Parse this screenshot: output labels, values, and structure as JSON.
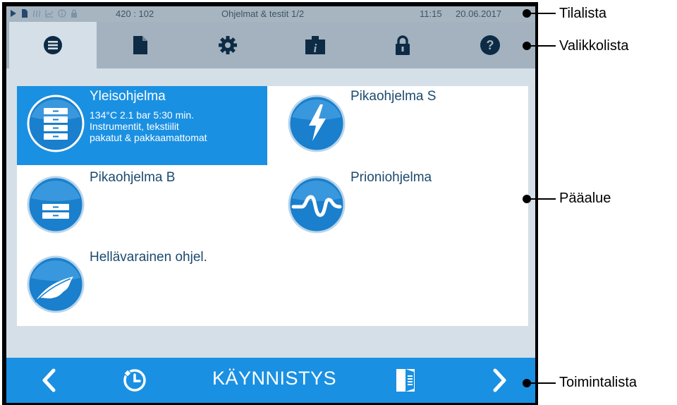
{
  "status_bar": {
    "counter": "420 : 102",
    "title": "Ohjelmat & testit 1/2",
    "time": "11:15",
    "date": "20.06.2017",
    "icons": [
      "play-icon",
      "document-icon",
      "steam-icon",
      "graph-icon",
      "info-icon",
      "lock-icon"
    ]
  },
  "menu_bar": {
    "tabs": [
      {
        "name": "programs-tab",
        "icon": "list-icon",
        "active": true
      },
      {
        "name": "documents-tab",
        "icon": "document-icon",
        "active": false
      },
      {
        "name": "settings-tab",
        "icon": "gear-icon",
        "active": false
      },
      {
        "name": "info-tab",
        "icon": "info-icon",
        "active": false
      },
      {
        "name": "lock-tab",
        "icon": "lock-icon",
        "active": false
      },
      {
        "name": "help-tab",
        "icon": "question-icon",
        "active": false
      }
    ]
  },
  "programs": [
    {
      "name": "Yleisohjelma",
      "icon": "stacked-trays-icon",
      "selected": true,
      "details": [
        "134°C 2.1 bar 5:30 min.",
        "Instrumentit, tekstiilit",
        "pakatut & pakkaamattomat"
      ]
    },
    {
      "name": "Pikaohjelma S",
      "icon": "lightning-icon",
      "selected": false,
      "details": []
    },
    {
      "name": "Pikaohjelma B",
      "icon": "single-tray-icon",
      "selected": false,
      "details": []
    },
    {
      "name": "Prioniohjelma",
      "icon": "prion-wave-icon",
      "selected": false,
      "details": []
    },
    {
      "name": "Hellävarainen ohjel.",
      "icon": "feather-icon",
      "selected": false,
      "details": []
    }
  ],
  "action_bar": {
    "start_label": "KÄYNNISTYS",
    "icons": [
      "back-arrow-icon",
      "timer-icon",
      "door-icon",
      "forward-arrow-icon"
    ]
  },
  "callouts": {
    "status_bar": "Tilalista",
    "menu_bar": "Valikkolista",
    "main_area": "Pääalue",
    "action_bar": "Toimintalista"
  },
  "colors": {
    "accent": "#1a90e2",
    "status_bar_bg": "#a7b5c0",
    "menu_bar_bg": "#a3b2be",
    "screen_bg": "#d4dfe7",
    "text_dark": "#1d4a6e"
  }
}
